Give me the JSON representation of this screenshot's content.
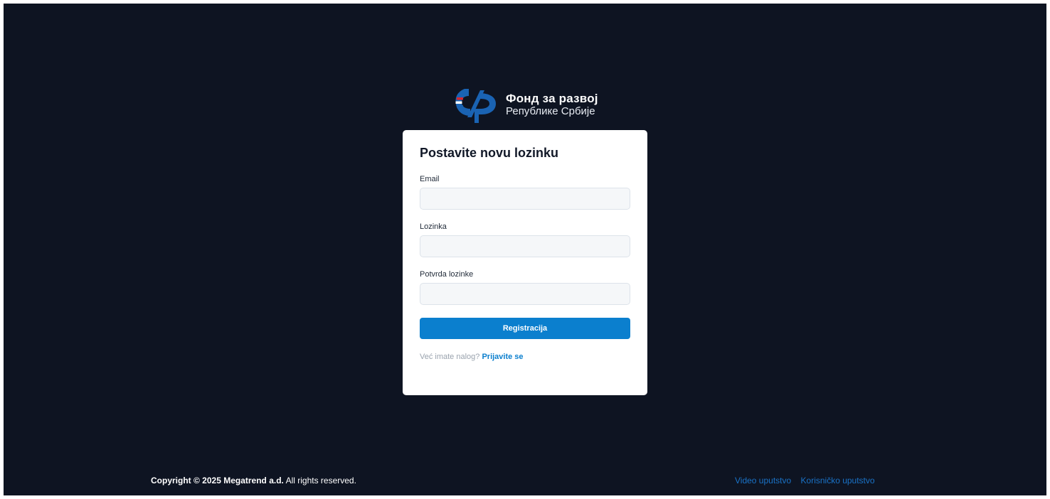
{
  "brand": {
    "line1": "Фонд за развој",
    "line2": "Републике Србије",
    "colors": {
      "mark_blue": "#1a63b3",
      "mark_red": "#d6262e",
      "mark_white": "#ffffff"
    }
  },
  "form": {
    "title": "Postavite novu lozinku",
    "email": {
      "label": "Email",
      "value": "",
      "placeholder": ""
    },
    "password": {
      "label": "Lozinka",
      "value": "",
      "placeholder": ""
    },
    "confirm_password": {
      "label": "Potvrda lozinke",
      "value": "",
      "placeholder": ""
    },
    "submit_label": "Registracija",
    "login_prompt": "Već imate nalog?",
    "login_link": "Prijavite se"
  },
  "footer": {
    "copyright_bold": "Copyright © 2025 Megatrend a.d.",
    "copyright_rest": " All rights reserved.",
    "links": [
      "Video uputstvo",
      "Korisničko uputstvo"
    ]
  },
  "colors": {
    "background": "#0e1422",
    "card": "#ffffff",
    "accent": "#0b7fce",
    "link": "#1a73c8"
  }
}
